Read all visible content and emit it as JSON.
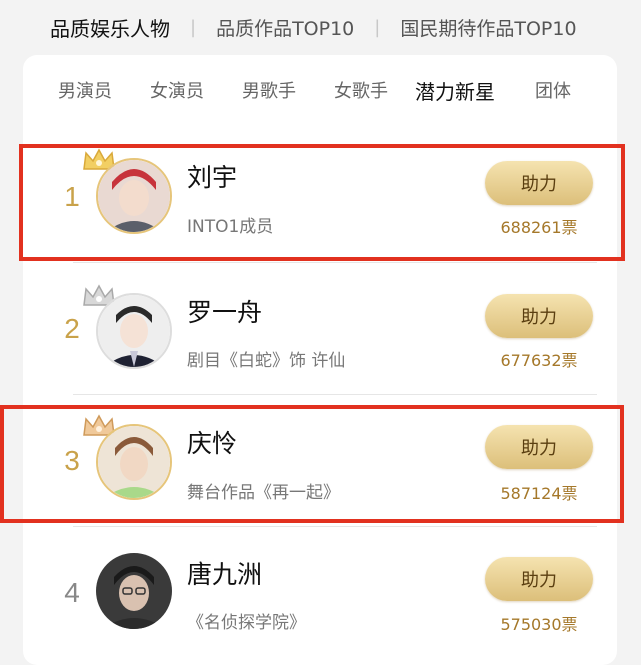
{
  "top_tabs": [
    "品质娱乐人物",
    "品质作品TOP10",
    "国民期待作品TOP10"
  ],
  "sub_tabs": [
    "男演员",
    "女演员",
    "男歌手",
    "女歌手",
    "潜力新星",
    "团体"
  ],
  "active_sub_tab": "潜力新星",
  "entries": [
    {
      "rank": "1",
      "name": "刘宇",
      "desc": "INTO1成员",
      "button": "助力",
      "votes": "688261票"
    },
    {
      "rank": "2",
      "name": "罗一舟",
      "desc": "剧目《白蛇》饰 许仙",
      "button": "助力",
      "votes": "677632票"
    },
    {
      "rank": "3",
      "name": "庆怜",
      "desc": "舞台作品《再一起》",
      "button": "助力",
      "votes": "587124票"
    },
    {
      "rank": "4",
      "name": "唐九洲",
      "desc": "《名侦探学院》",
      "button": "助力",
      "votes": "575030票"
    }
  ],
  "icons": {
    "crown_gold": "crown-icon",
    "crown_silver": "crown-icon"
  },
  "colors": {
    "accent_gold": "#c9a24a",
    "highlight": "#e2311f",
    "button_text": "#5a3e10"
  }
}
